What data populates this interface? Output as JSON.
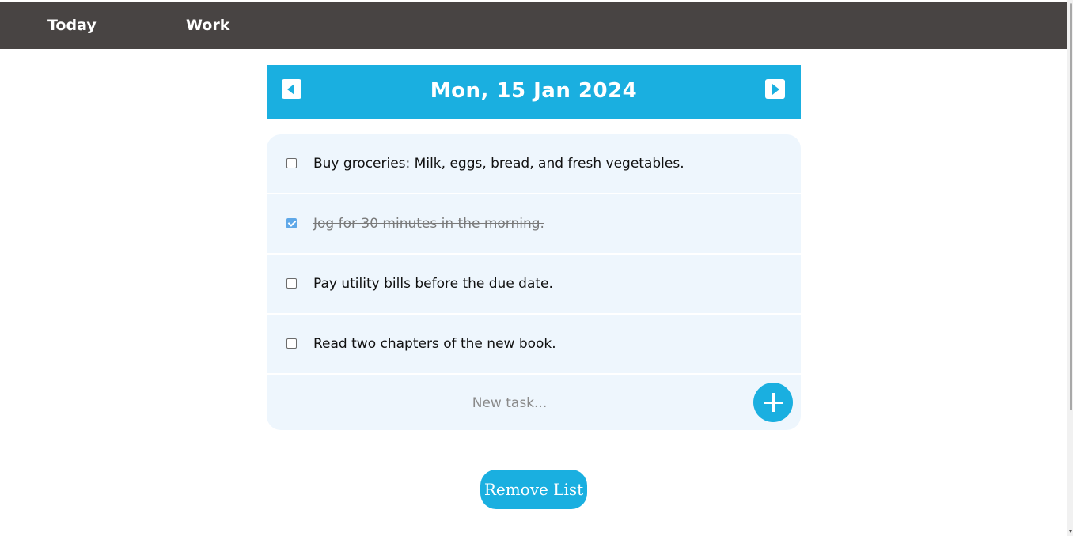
{
  "nav": {
    "tabs": [
      {
        "label": "Today"
      },
      {
        "label": "Work"
      }
    ]
  },
  "date_header": {
    "title": "Mon, 15 Jan 2024",
    "prev_icon": "caret-left-icon",
    "next_icon": "caret-right-icon"
  },
  "tasks": [
    {
      "text": "Buy groceries: Milk, eggs, bread, and fresh vegetables.",
      "done": false
    },
    {
      "text": "Jog for 30 minutes in the morning.",
      "done": true
    },
    {
      "text": "Pay utility bills before the due date.",
      "done": false
    },
    {
      "text": "Read two chapters of the new book.",
      "done": false
    }
  ],
  "new_task": {
    "placeholder": "New task...",
    "add_icon": "plus-icon"
  },
  "remove_list_label": "Remove List",
  "colors": {
    "nav_background": "#484443",
    "accent": "#1aafe0",
    "card_background": "#eef6fd"
  }
}
